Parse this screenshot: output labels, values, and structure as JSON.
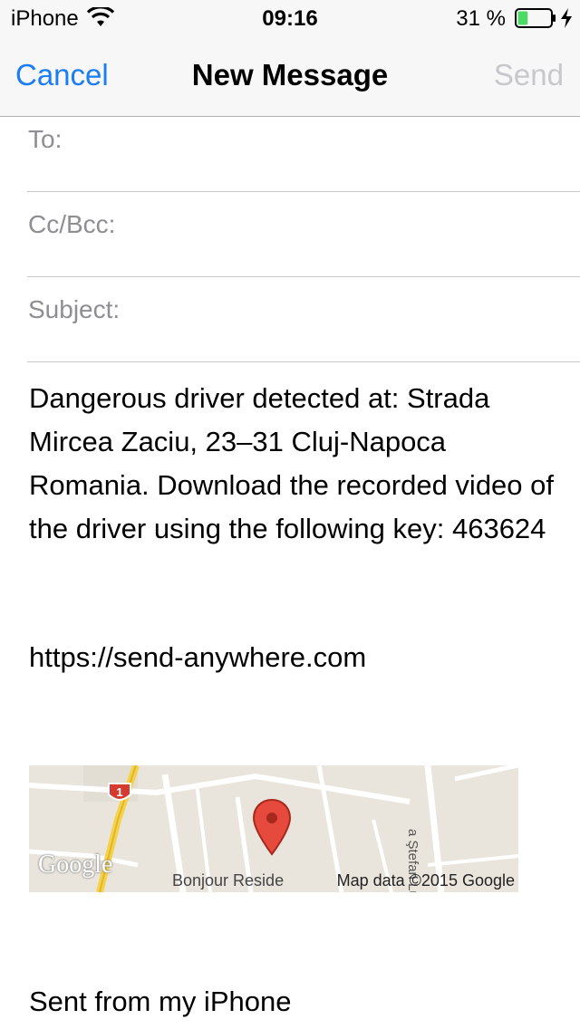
{
  "status_bar": {
    "carrier": "iPhone",
    "time": "09:16",
    "battery_percent": "31 %",
    "battery_level": 0.31,
    "battery_color": "#4cd964",
    "wifi_icon": "wifi-icon",
    "charging_icon": "bolt-icon"
  },
  "nav": {
    "cancel_label": "Cancel",
    "title": "New Message",
    "send_label": "Send",
    "accent": "#1a7df5",
    "disabled": "#c7c7cc"
  },
  "fields": {
    "to_label": "To:",
    "ccbcc_label": "Cc/Bcc:",
    "subject_label": "Subject:"
  },
  "body": {
    "message": "Dangerous driver detected at: Strada Mircea Zaciu, 23–31 Cluj-Napoca Romania. Download the recorded video of the driver using the following key: 463624",
    "link": "https://send-anywhere.com",
    "signature": "Sent from my iPhone"
  },
  "map": {
    "logo": "Google",
    "place_label": "Bonjour Reside",
    "street_label": "a Ştefan Luchi",
    "credit": "Map data ©2015 Google",
    "road_badge": "1",
    "pin_icon": "map-pin-icon"
  }
}
